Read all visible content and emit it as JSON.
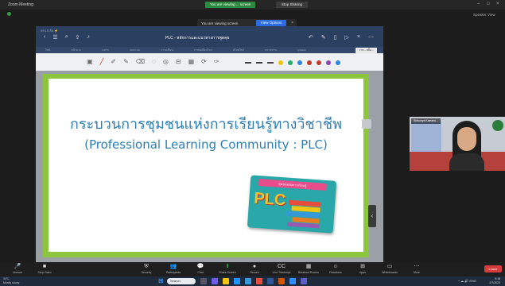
{
  "window": {
    "app_title": "Zoom Meeting",
    "share_banner": "You are viewing ... screen",
    "stop_share_label": "Stop Sharing",
    "minimize": "–",
    "maximize": "□",
    "close": "×",
    "top_right": "Speaker  View"
  },
  "viewing_banner": {
    "text": "You are viewing screen",
    "options_label": "View Options",
    "close": "×"
  },
  "ppt": {
    "statusline": "09:15 ล้อ ⚡",
    "doc_title": "PLC - หลักการและแนวทางการพูดคุย",
    "tabs": [
      "ไฟล์",
      "หน้าแรก",
      "แทรก",
      "ออกแบบ",
      "การเปลี่ยน",
      "ภาพเคลื่อนไหว",
      "สไลด์โชว์",
      "ตรวจทาน",
      "มุมมอง"
    ],
    "active_tab": "วาด - สล็อ...",
    "toolbar_icons": [
      "select-icon",
      "pen-icon",
      "pencil-icon",
      "highlighter-icon",
      "eraser-icon",
      "lasso-icon",
      "shapes-icon",
      "ruler-icon",
      "ink-to-text-icon",
      "replay-icon",
      "marker-icon"
    ],
    "pen_colors": [
      "#2b2b2b",
      "#3a3a3a",
      "#f1c40f",
      "#27ae60",
      "#2e86de",
      "#c0392b",
      "#c0392b",
      "#8e44ad",
      "#2e86de"
    ]
  },
  "slide": {
    "title_th": "กระบวนการชุมชนแห่งการเรียนรู้ทางวิชาชีพ",
    "title_en": "(Professional Learning Community : PLC)",
    "card_banner": "ชุมชนแห่งการเรียนรู้",
    "card_label": "PLC",
    "border_color": "#8cc63f",
    "title_color": "#2d7fb3"
  },
  "webcam": {
    "name": "Sirikunya Kaewbu..."
  },
  "side_panel": {
    "chevron": "‹"
  },
  "controls": {
    "items": [
      {
        "label": "Unmute",
        "icon": "🎤"
      },
      {
        "label": "Stop Video",
        "icon": "■"
      },
      {
        "label": "Security",
        "icon": "⛨"
      },
      {
        "label": "Participants",
        "icon": "👥"
      },
      {
        "label": "Chat",
        "icon": "💬"
      },
      {
        "label": "Share Screen",
        "icon": "⬆"
      },
      {
        "label": "Record",
        "icon": "●"
      },
      {
        "label": "Live Transcript",
        "icon": "CC"
      },
      {
        "label": "Breakout Rooms",
        "icon": "▦"
      },
      {
        "label": "Reactions",
        "icon": "☺"
      },
      {
        "label": "Apps",
        "icon": "⊞"
      },
      {
        "label": "Whiteboards",
        "icon": "▭"
      },
      {
        "label": "More",
        "icon": "⋯"
      }
    ],
    "leave_label": "Leave"
  },
  "taskbar": {
    "weather_temp": "34°C",
    "weather_text": "Mostly sunny",
    "search_label": "Search",
    "time": "9:18",
    "date": "2/7/2023",
    "tray": "^ ☁ 🔊 ENG"
  }
}
